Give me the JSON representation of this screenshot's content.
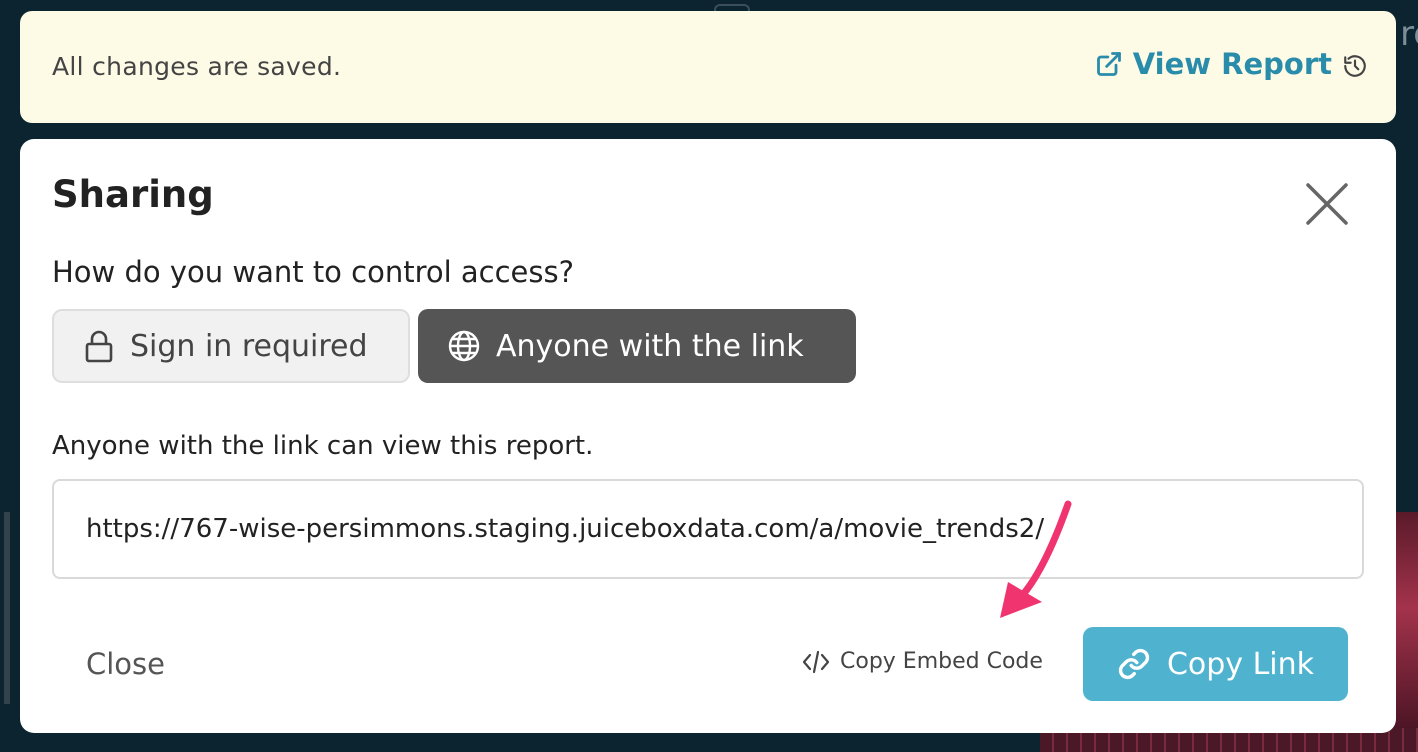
{
  "banner": {
    "status_text": "All changes are saved.",
    "view_report_label": "View Report",
    "accent_color": "#2a8cab",
    "background_color": "#fdfbe6"
  },
  "background": {
    "corner_text": "rc"
  },
  "dialog": {
    "title": "Sharing",
    "question": "How do you want to control access?",
    "access_options": [
      {
        "label": "Sign in required",
        "icon": "lock-icon",
        "selected": false
      },
      {
        "label": "Anyone with the link",
        "icon": "globe-icon",
        "selected": true
      }
    ],
    "description": "Anyone with the link can view this report.",
    "share_url": "https://767-wise-persimmons.staging.juiceboxdata.com/a/movie_trends2/",
    "close_label": "Close",
    "copy_embed_label": "Copy Embed Code",
    "copy_link_label": "Copy Link",
    "copy_link_color": "#4fb3cf",
    "selected_option_color": "#555555"
  },
  "annotation": {
    "arrow_color": "#f0346f"
  }
}
